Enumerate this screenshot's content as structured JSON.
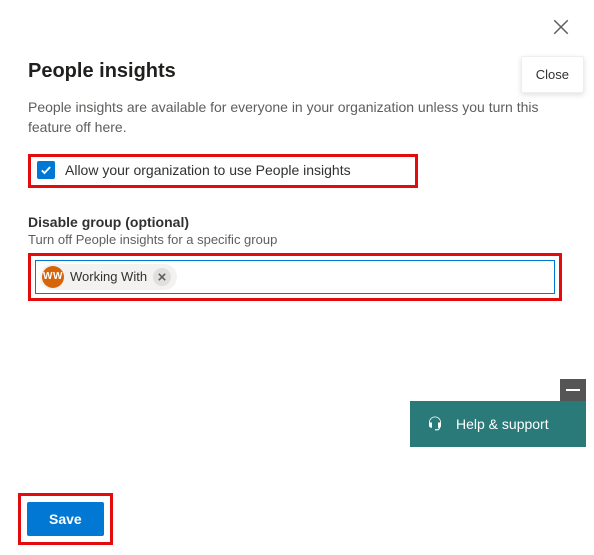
{
  "header": {
    "title": "People insights",
    "close_tooltip": "Close"
  },
  "description": "People insights are available for everyone in your organization unless you turn this feature off here.",
  "allow_checkbox": {
    "checked": true,
    "label": "Allow your organization to use People insights"
  },
  "disable_group": {
    "label": "Disable group (optional)",
    "sublabel": "Turn off People insights for a specific group",
    "chip": {
      "avatar_initials": "WW",
      "name": "Working With"
    },
    "input_value": ""
  },
  "help_widget": {
    "label": "Help & support"
  },
  "footer": {
    "save_label": "Save"
  },
  "colors": {
    "primary": "#0078d4",
    "teal": "#2a7a7a",
    "highlight": "#e30b0b"
  }
}
